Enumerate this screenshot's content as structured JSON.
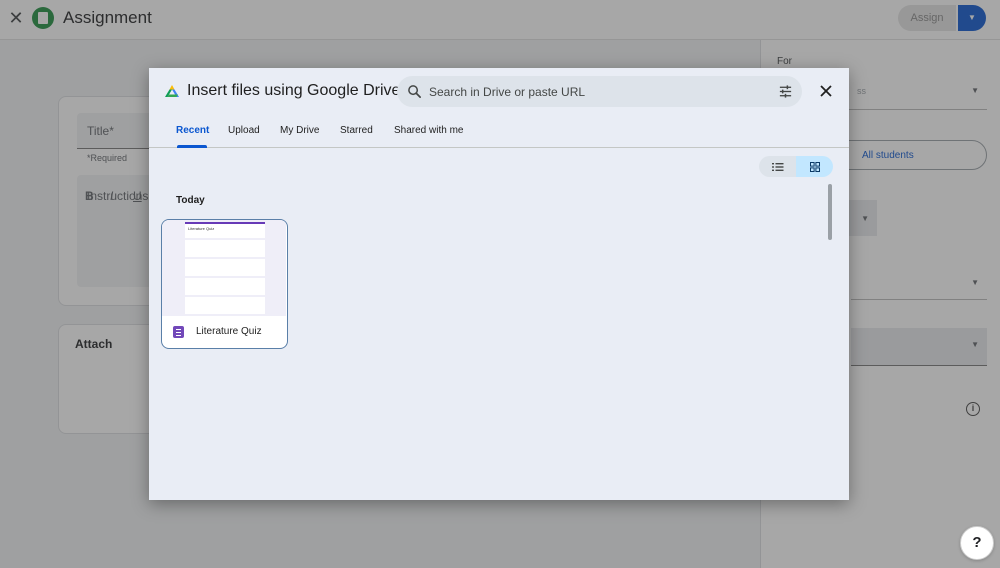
{
  "app": {
    "title": "Assignment",
    "assign_label": "Assign"
  },
  "form": {
    "title_placeholder": "Title*",
    "required_note": "*Required",
    "instructions_placeholder": "Instructions (",
    "format_bold": "B",
    "format_italic": "I",
    "format_underline": "U",
    "attach_label": "Attach"
  },
  "sidebar": {
    "for_label": "For",
    "for_value": "ss",
    "students_label": "All students"
  },
  "dialog": {
    "title": "Insert files using Google Drive",
    "search_placeholder": "Search in Drive or paste URL",
    "tabs": [
      {
        "label": "Recent",
        "active": true
      },
      {
        "label": "Upload",
        "active": false
      },
      {
        "label": "My Drive",
        "active": false
      },
      {
        "label": "Starred",
        "active": false
      },
      {
        "label": "Shared with me",
        "active": false
      }
    ],
    "view_mode": "grid",
    "section_label": "Today",
    "files": [
      {
        "name": "Literature Quiz",
        "type_icon": "google-forms-icon",
        "preview_title": "Literature Quiz"
      }
    ]
  },
  "colors": {
    "accent": "#0b57d0",
    "forms_purple": "#7248b9",
    "dialog_bg": "#e9edf5",
    "grid_toggle_active": "#c2e7ff"
  }
}
